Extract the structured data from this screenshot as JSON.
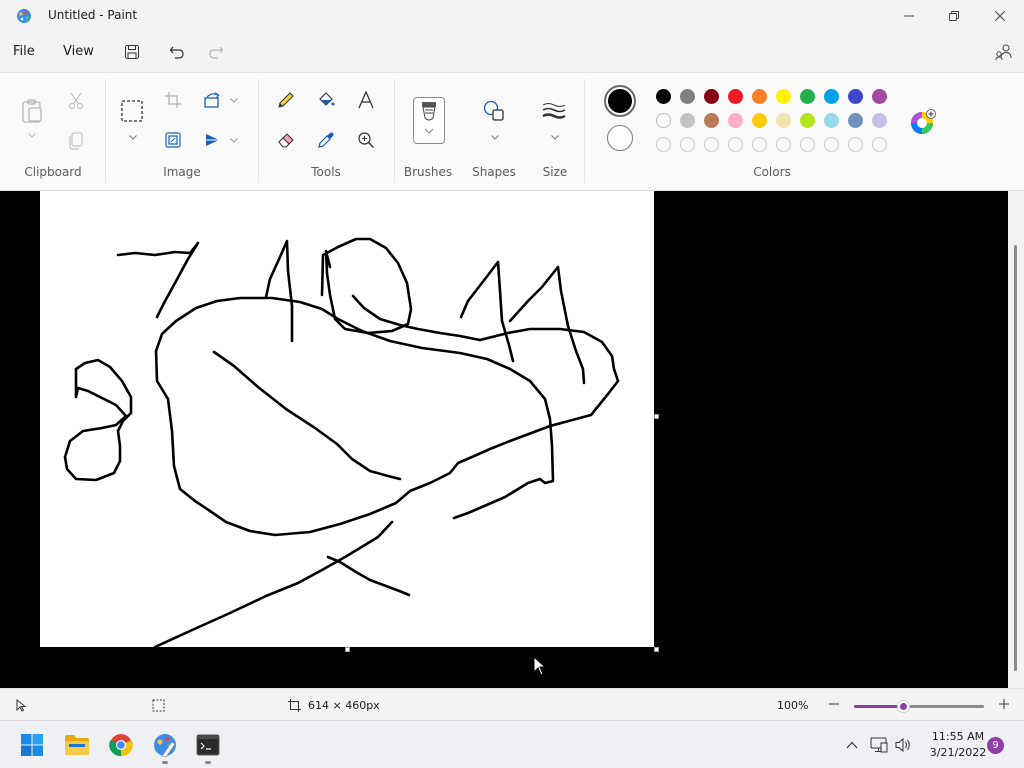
{
  "window": {
    "title": "Untitled - Paint"
  },
  "menu": {
    "file": "File",
    "view": "View"
  },
  "ribbon": {
    "groups": {
      "clipboard": "Clipboard",
      "image": "Image",
      "tools": "Tools",
      "brushes": "Brushes",
      "shapes": "Shapes",
      "size": "Size",
      "colors": "Colors"
    },
    "color1": "#000000",
    "color2": "#ffffff",
    "palette": [
      [
        "#000000",
        "#7f7f7f",
        "#880015",
        "#ed1c24",
        "#ff7f27",
        "#fff200",
        "#22b14c",
        "#00a2e8",
        "#3f48cc",
        "#a349a4"
      ],
      [
        "#ffffff",
        "#c3c3c3",
        "#b97a57",
        "#ffaec9",
        "#ffc90e",
        "#efe4b0",
        "#b5e61d",
        "#99d9ea",
        "#7092be",
        "#c8bfe7"
      ],
      [
        "",
        "",
        "",
        "",
        "",
        "",
        "",
        "",
        "",
        ""
      ]
    ]
  },
  "canvas": {
    "background": "#ffffff",
    "stroke_color": "#000000"
  },
  "status": {
    "canvas_size": "614 × 460px",
    "zoom": "100%",
    "zoom_fraction": 0.38
  },
  "taskbar": {
    "time": "11:55 AM",
    "date": "3/21/2022",
    "notification_count": "9",
    "apps": [
      "start-icon",
      "file-explorer-icon",
      "chrome-icon",
      "paint-icon",
      "terminal-icon"
    ]
  },
  "colors": {
    "accent": "#8e3fa8",
    "workspace": "#000000"
  }
}
